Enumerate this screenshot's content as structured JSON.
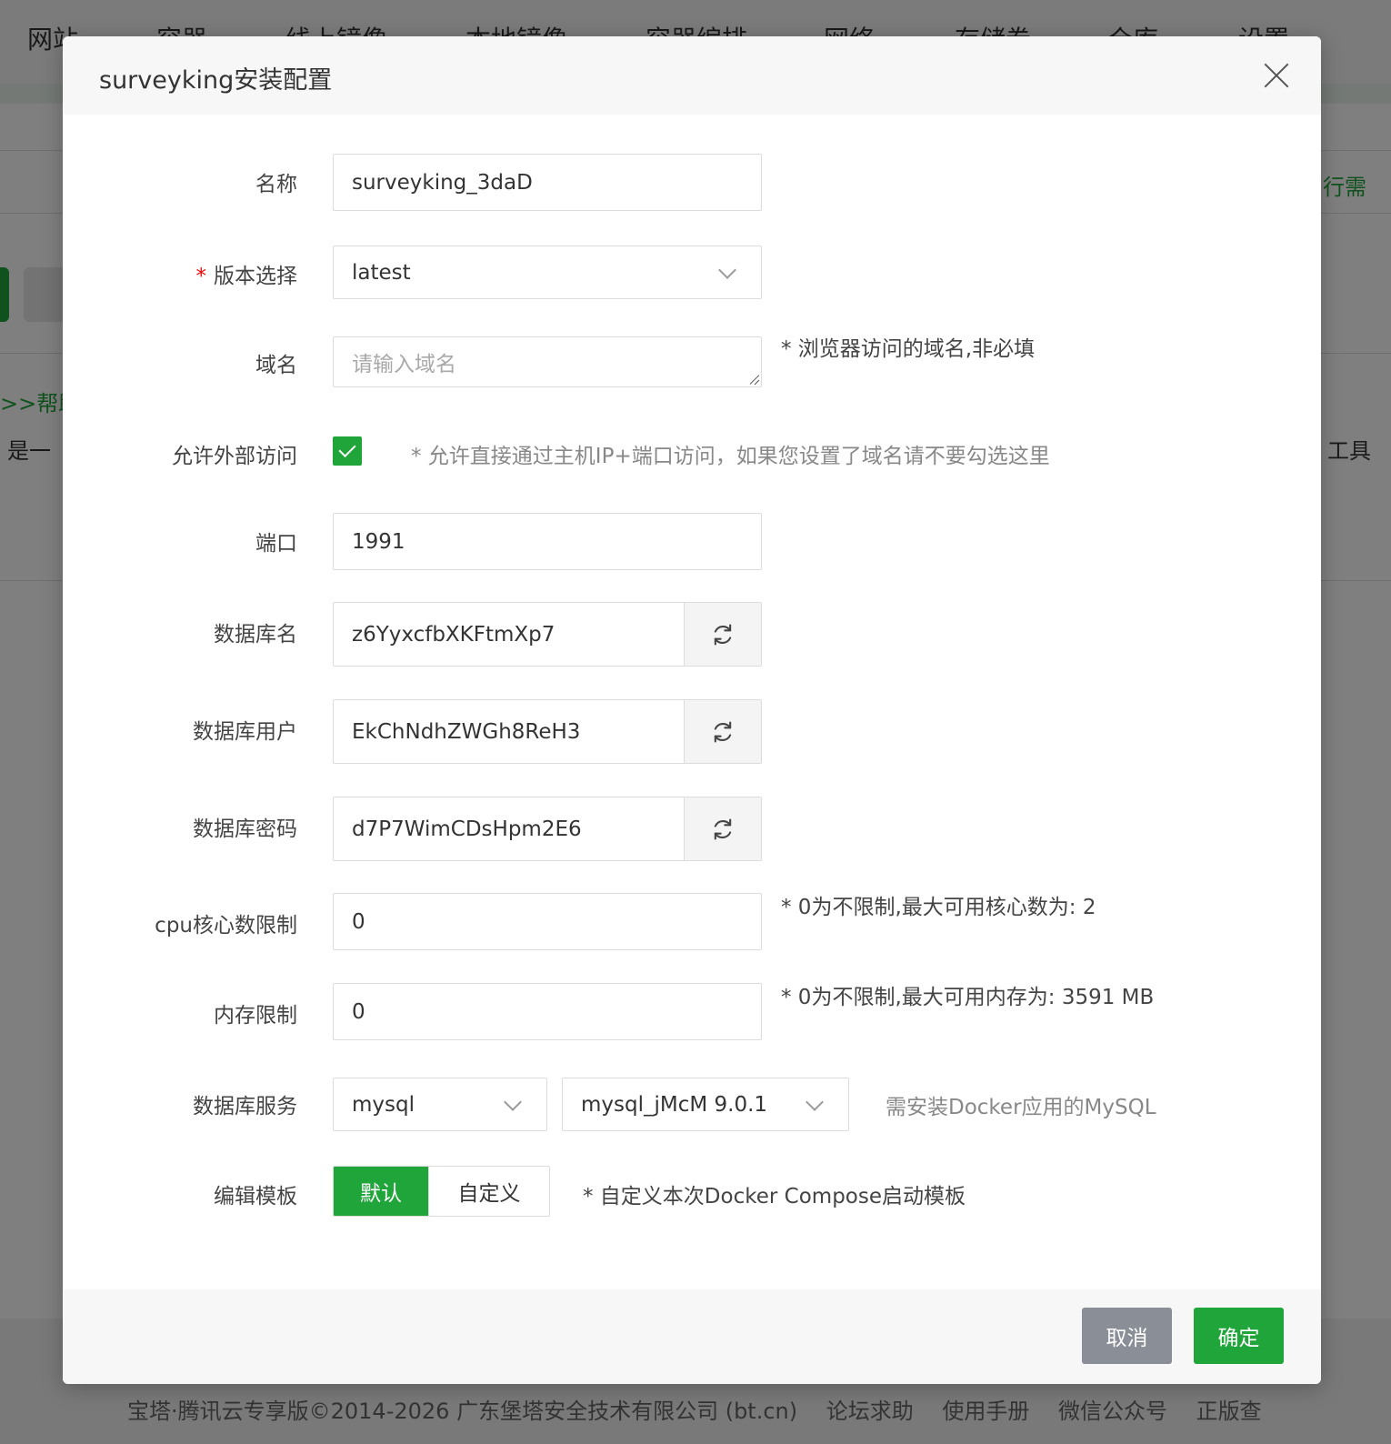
{
  "background": {
    "nav_items": [
      "网站",
      "容器",
      "线上镜像",
      "本地镜像",
      "容器编排",
      "网络",
      "存储卷",
      "仓库",
      "设置"
    ],
    "help_link": ">>帮助",
    "left_snippet": "是一",
    "right_snippet_1": "行需",
    "right_snippet_2": "工具",
    "footer": {
      "copyright": "宝塔·腾讯云专享版©2014-2026 广东堡塔安全技术有限公司 (bt.cn)",
      "links": [
        "论坛求助",
        "使用手册",
        "微信公众号",
        "正版查"
      ]
    }
  },
  "dialog": {
    "title": "surveyking安装配置",
    "fields": {
      "name": {
        "label": "名称",
        "value": "surveyking_3daD"
      },
      "version": {
        "label": "版本选择",
        "required_mark": "*",
        "value": "latest"
      },
      "domain": {
        "label": "域名",
        "placeholder": "请输入域名",
        "hint": "* 浏览器访问的域名,非必填"
      },
      "external": {
        "label": "允许外部访问",
        "checked": true,
        "hint": "* 允许直接通过主机IP+端口访问，如果您设置了域名请不要勾选这里"
      },
      "port": {
        "label": "端口",
        "value": "1991"
      },
      "db_name": {
        "label": "数据库名",
        "value": "z6YyxcfbXKFtmXp7"
      },
      "db_user": {
        "label": "数据库用户",
        "value": "EkChNdhZWGh8ReH3"
      },
      "db_password": {
        "label": "数据库密码",
        "value": "d7P7WimCDsHpm2E6"
      },
      "cpu": {
        "label": "cpu核心数限制",
        "value": "0",
        "hint": "* 0为不限制,最大可用核心数为: 2"
      },
      "memory": {
        "label": "内存限制",
        "value": "0",
        "hint": "* 0为不限制,最大可用内存为: 3591 MB"
      },
      "db_service": {
        "label": "数据库服务",
        "type_value": "mysql",
        "instance_value": "mysql_jMcM 9.0.1",
        "hint": "需安装Docker应用的MySQL"
      },
      "template": {
        "label": "编辑模板",
        "default_label": "默认",
        "custom_label": "自定义",
        "hint": "* 自定义本次Docker Compose启动模板"
      }
    },
    "buttons": {
      "cancel": "取消",
      "ok": "确定"
    }
  },
  "colors": {
    "accent": "#20a53a",
    "required": "#ef0808",
    "cancel": "#8a8f97"
  }
}
